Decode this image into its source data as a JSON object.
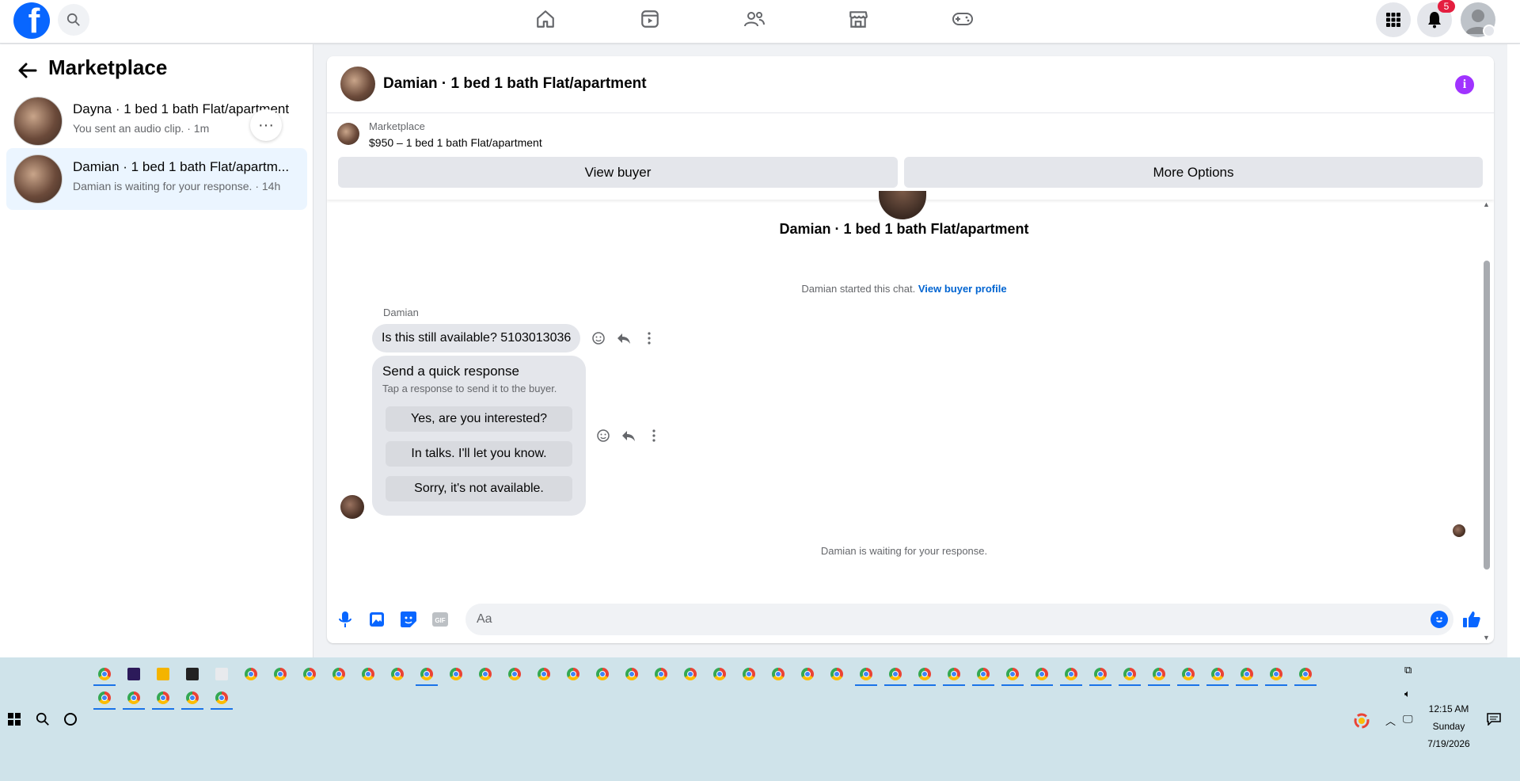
{
  "topnav": {
    "logo": "f",
    "icons": [
      "home-icon",
      "video-icon",
      "friends-icon",
      "marketplace-icon",
      "gaming-icon"
    ],
    "notifications_count": "5"
  },
  "sidebar": {
    "title": "Marketplace",
    "conversations": [
      {
        "title": "Dayna · 1 bed 1 bath Flat/apartment",
        "subtitle": "You sent an audio clip. · 1m",
        "active": false
      },
      {
        "title": "Damian · 1 bed 1 bath Flat/apartm...",
        "subtitle": "Damian is waiting for your response. · 14h",
        "active": true
      }
    ],
    "more_label": "···"
  },
  "chat": {
    "header_title": "Damian · 1 bed 1 bath Flat/apartment",
    "listing": {
      "label": "Marketplace",
      "price_title": "$950 – 1 bed 1 bath Flat/apartment",
      "view_buyer": "View buyer",
      "more_options": "More Options"
    },
    "thread_title": "Damian · 1 bed 1 bath Flat/apartment",
    "started_text": "Damian started this chat.",
    "started_link": "View buyer profile",
    "sender_name": "Damian",
    "message": "Is this still available? 5103013036",
    "quick_response": {
      "title": "Send a quick response",
      "subtitle": "Tap a response to send it to the buyer.",
      "options": [
        "Yes, are you interested?",
        "In talks. I'll let you know.",
        "Sorry, it's not available."
      ]
    },
    "waiting_text": "Damian is waiting for your response.",
    "composer_placeholder": "Aa"
  },
  "taskbar": {
    "time": "12:15 AM",
    "day": "Sunday",
    "date": "7/19/2026"
  },
  "colors": {
    "accent": "#0866ff",
    "link": "#0064d1",
    "info": "#a033ff",
    "badge": "#e41e3f"
  }
}
